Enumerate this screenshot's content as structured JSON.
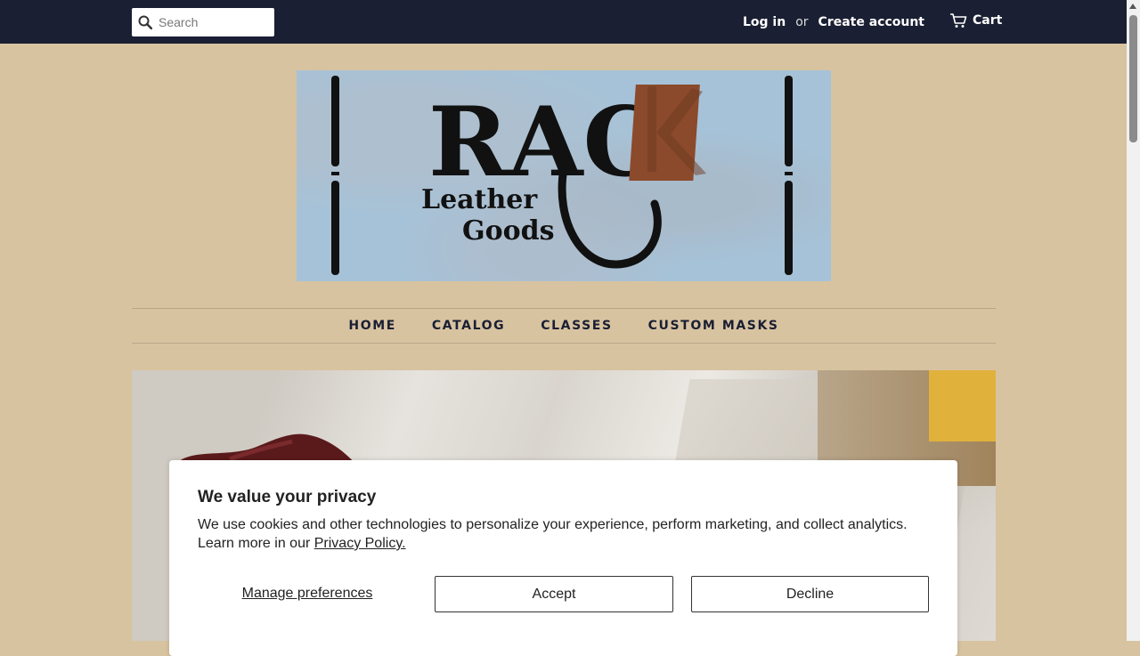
{
  "header": {
    "search": {
      "placeholder": "Search"
    },
    "login_label": "Log in",
    "or_label": "or",
    "create_account_label": "Create account",
    "cart_label": "Cart"
  },
  "logo": {
    "brand_word": "RACK",
    "sub_line_1": "Leather",
    "sub_line_2": "Goods",
    "background_color": "#a6c2d8",
    "accent_color": "#8b4a2b"
  },
  "nav": {
    "items": [
      {
        "label": "HOME"
      },
      {
        "label": "CATALOG"
      },
      {
        "label": "CLASSES"
      },
      {
        "label": "CUSTOM MASKS"
      }
    ]
  },
  "privacy": {
    "title": "We value your privacy",
    "body": "We use cookies and other technologies to personalize your experience, perform marketing, and collect analytics. Learn more in our ",
    "policy_link": "Privacy Policy.",
    "manage_label": "Manage preferences",
    "accept_label": "Accept",
    "decline_label": "Decline"
  },
  "colors": {
    "topbar": "#1a1f33",
    "page_bg": "#d8c3a0"
  }
}
